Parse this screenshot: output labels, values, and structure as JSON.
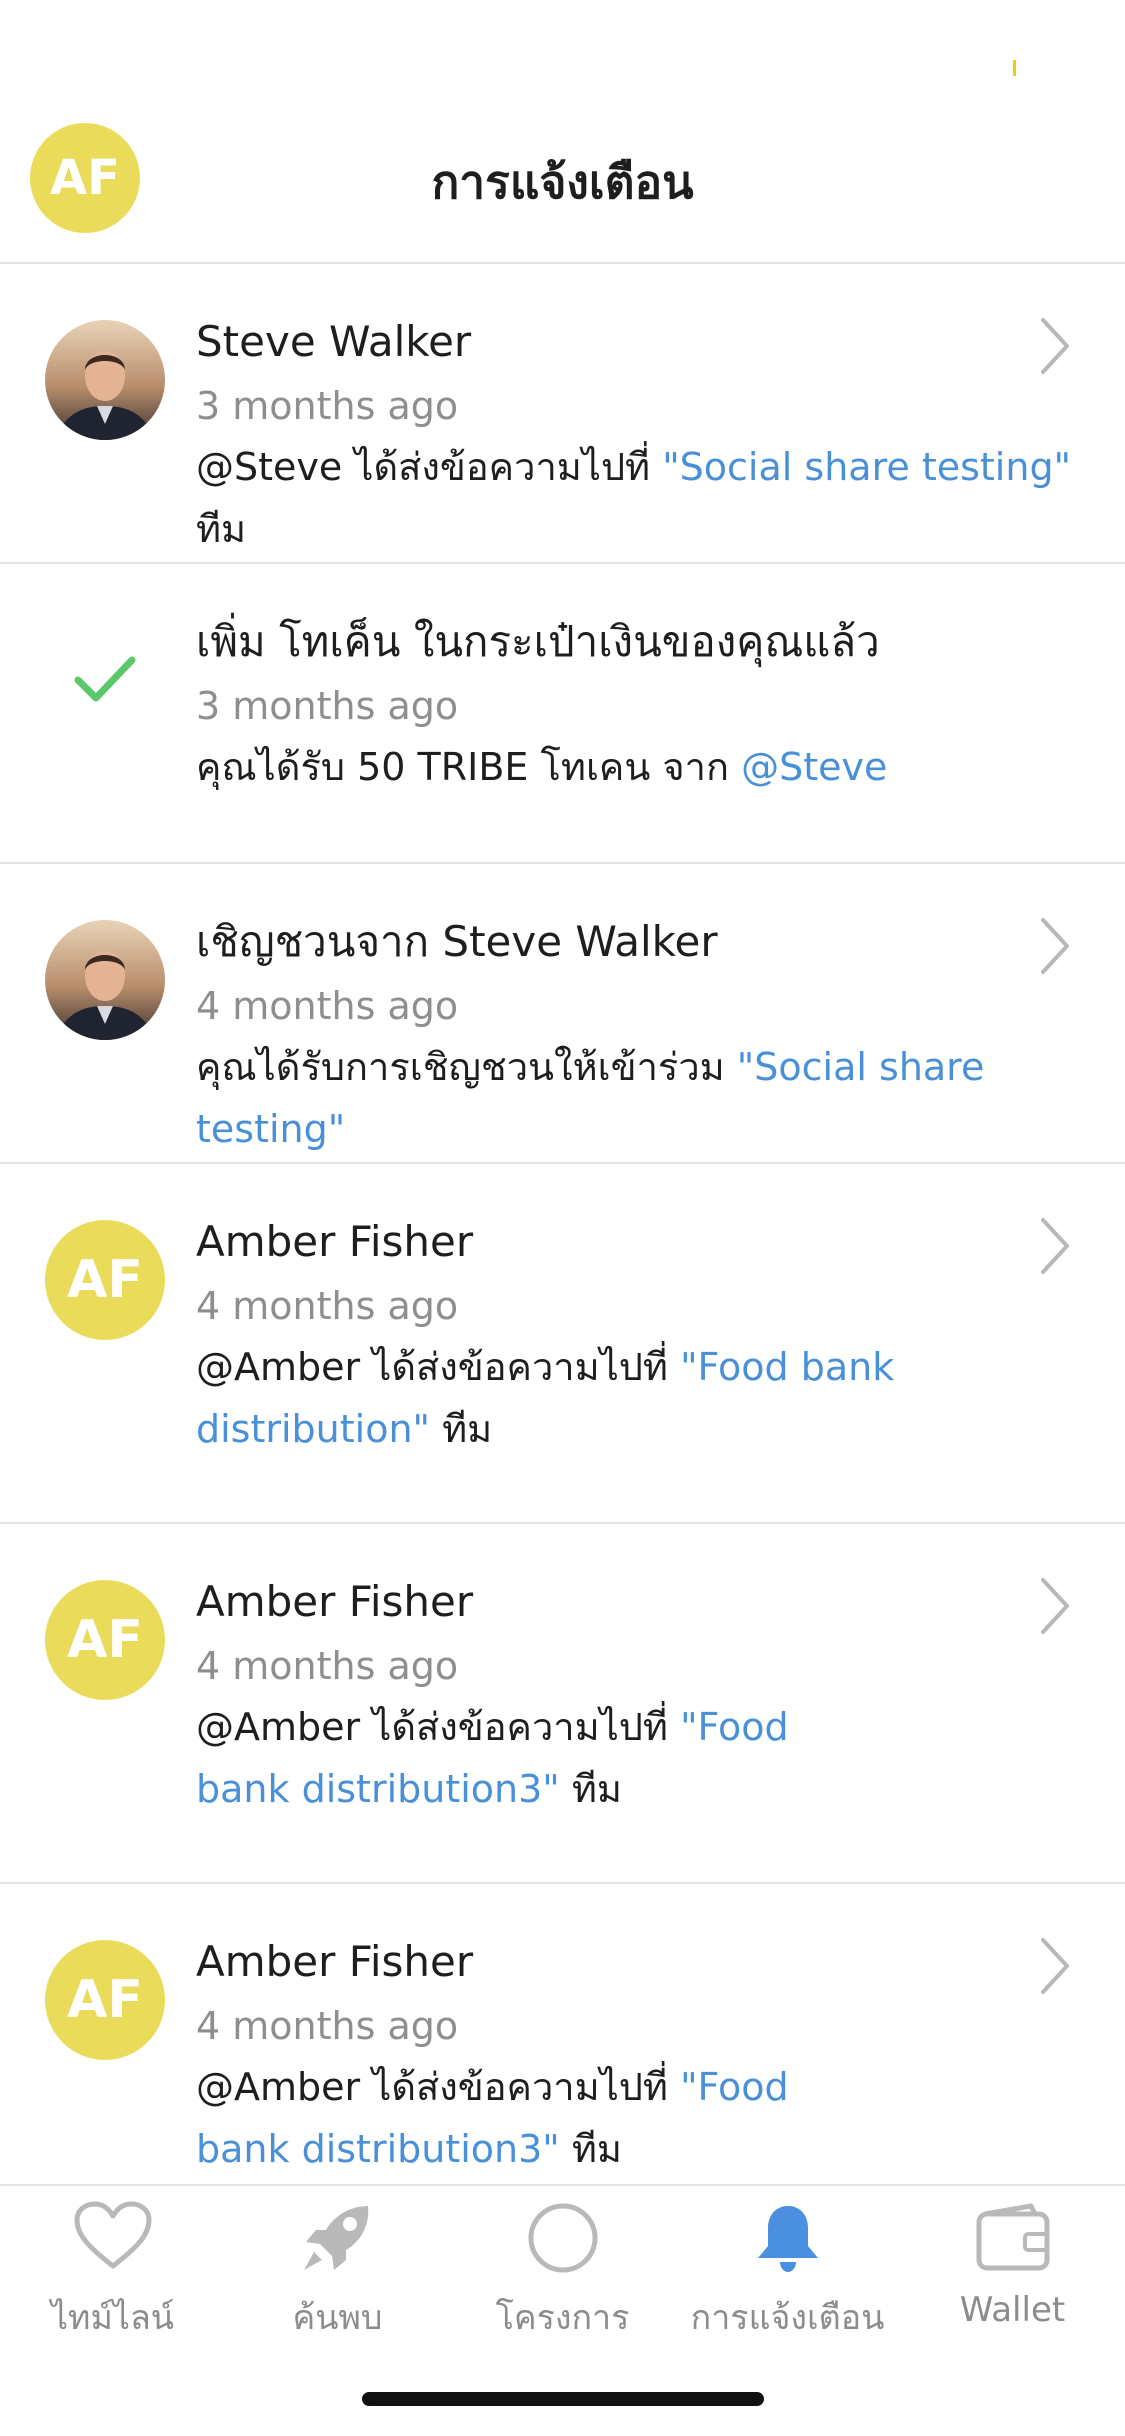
{
  "header": {
    "avatar_initials": "AF",
    "title": "การแจ้งเตือน"
  },
  "notifications": [
    {
      "avatar": "photo",
      "title": "Steve Walker",
      "time": "3 months ago",
      "message_prefix": "@Steve ได้ส่งข้อความไปที่ ",
      "message_link": "\"Social share testing\"",
      "message_suffix": " ทีม"
    },
    {
      "avatar": "check-icon",
      "title": "เพิ่ม โทเค็น ในกระเป๋าเงินของคุณแล้ว",
      "time": "3 months ago",
      "message_prefix": "คุณได้รับ 50 TRIBE โทเคน จาก ",
      "message_link": "@Steve",
      "message_suffix": ""
    },
    {
      "avatar": "photo",
      "title": "เชิญชวนจาก Steve Walker",
      "time": "4 months ago",
      "message_prefix": "คุณได้รับการเชิญชวนให้เข้าร่วม ",
      "message_link": "\"Social share testing\"",
      "message_suffix": ""
    },
    {
      "avatar": "AF",
      "title": "Amber Fisher",
      "time": "4 months ago",
      "message_prefix": "@Amber ได้ส่งข้อความไปที่ ",
      "message_link": "\"Food bank distribution\"",
      "message_suffix": " ทีม"
    },
    {
      "avatar": "AF",
      "title": "Amber Fisher",
      "time": "4 months ago",
      "message_prefix": "@Amber ได้ส่งข้อความไปที่ ",
      "message_link": "\"Food bank distribution3\"",
      "message_suffix": " ทีม"
    },
    {
      "avatar": "AF",
      "title": "Amber Fisher",
      "time": "4 months ago",
      "message_prefix": "@Amber ได้ส่งข้อความไปที่ ",
      "message_link": "\"Food bank distribution3\"",
      "message_suffix": " ทีม"
    }
  ],
  "tabbar": {
    "tabs": [
      {
        "label": "ไทม์ไลน์",
        "icon": "heart-icon"
      },
      {
        "label": "ค้นพบ",
        "icon": "rocket-icon"
      },
      {
        "label": "โครงการ",
        "icon": "circle-icon"
      },
      {
        "label": "การแจ้งเตือน",
        "icon": "bell-icon",
        "active": true
      },
      {
        "label": "Wallet",
        "icon": "wallet-icon"
      }
    ]
  },
  "colors": {
    "accent_yellow": "#ebdb5a",
    "link_blue": "#4a90d9",
    "active_tab_blue": "#4a8fe0",
    "check_green": "#5ac86a",
    "muted_gray": "#8e8e8e"
  }
}
